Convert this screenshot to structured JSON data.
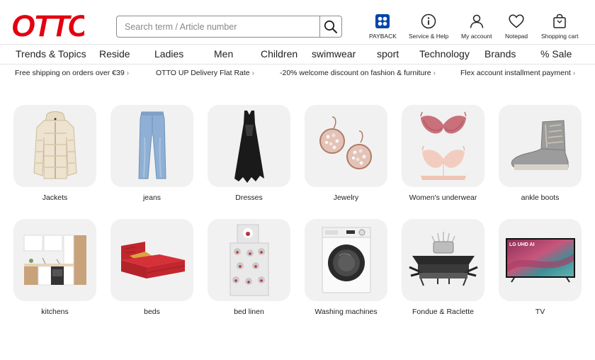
{
  "header": {
    "logo_text": "OTTO",
    "search": {
      "placeholder": "Search term / Article number",
      "value": ""
    },
    "utilities": [
      {
        "label": "PAYBACK",
        "icon": "payback-icon"
      },
      {
        "label": "Service & Help",
        "icon": "info-icon"
      },
      {
        "label": "My account",
        "icon": "person-icon"
      },
      {
        "label": "Notepad",
        "icon": "heart-icon"
      },
      {
        "label": "Shopping cart",
        "icon": "cart-icon"
      }
    ]
  },
  "nav": {
    "items": [
      "Trends & Topics",
      "Reside",
      "Ladies",
      "Men",
      "Children",
      "swimwear",
      "sport",
      "Technology",
      "Brands",
      "% Sale"
    ]
  },
  "usp": {
    "items": [
      "Free shipping on orders over €39",
      "OTTO UP Delivery Flat Rate",
      "-20% welcome discount on fashion & furniture",
      "Flex account installment payment"
    ]
  },
  "categories": [
    {
      "label": "Jackets",
      "image": "jacket-image"
    },
    {
      "label": "jeans",
      "image": "jeans-image"
    },
    {
      "label": "Dresses",
      "image": "dress-image"
    },
    {
      "label": "Jewelry",
      "image": "earrings-image"
    },
    {
      "label": "Women's underwear",
      "image": "bra-image"
    },
    {
      "label": "ankle boots",
      "image": "boot-image"
    },
    {
      "label": "kitchens",
      "image": "kitchen-image"
    },
    {
      "label": "beds",
      "image": "bed-image"
    },
    {
      "label": "bed linen",
      "image": "bed-linen-image"
    },
    {
      "label": "Washing machines",
      "image": "washing-machine-image"
    },
    {
      "label": "Fondue & Raclette",
      "image": "raclette-image"
    },
    {
      "label": "TV",
      "image": "tv-image",
      "screen_brand": "LG UHD AI"
    }
  ],
  "colors": {
    "brand_red": "#e3000f",
    "payback_blue": "#0046aa",
    "tile_bg": "#f1f1f1"
  }
}
